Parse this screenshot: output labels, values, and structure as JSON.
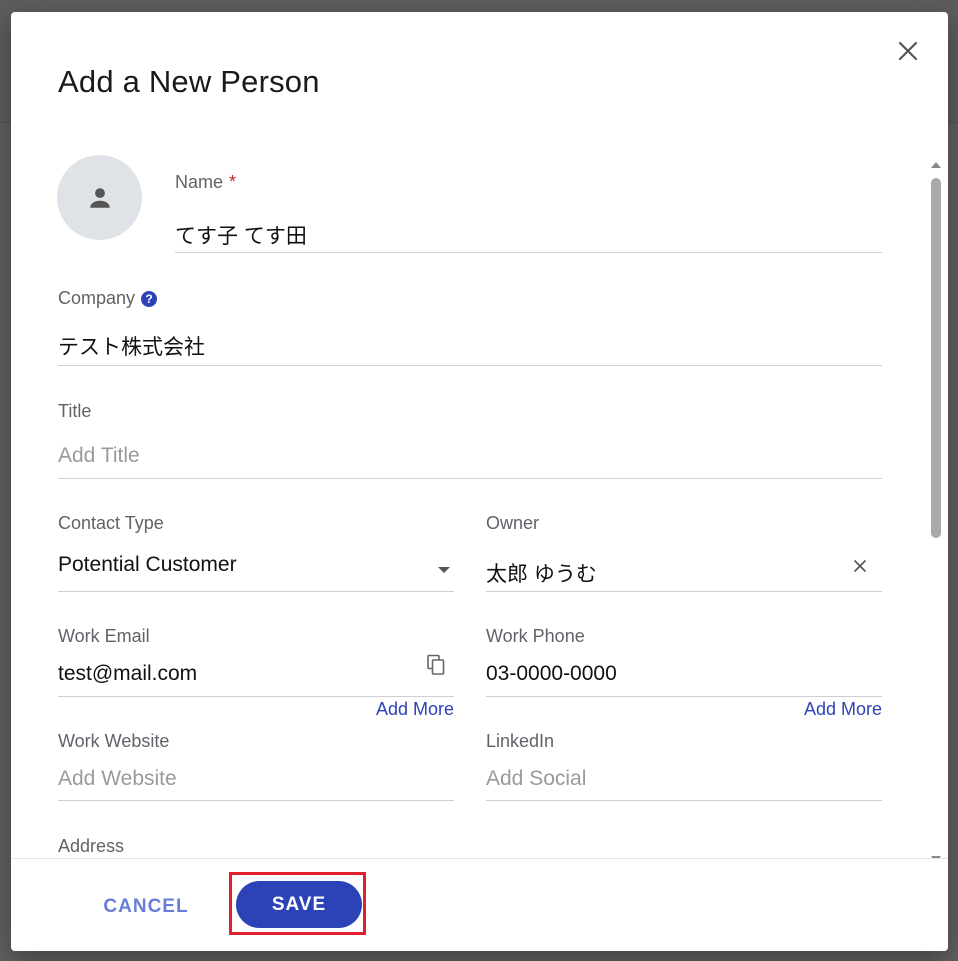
{
  "dialog": {
    "title": "Add a New Person"
  },
  "fields": {
    "name": {
      "label": "Name",
      "required_mark": "*",
      "value": "てす子 てす田"
    },
    "company": {
      "label": "Company",
      "help": "?",
      "value": "テスト株式会社"
    },
    "title": {
      "label": "Title",
      "placeholder": "Add Title"
    },
    "contact_type": {
      "label": "Contact Type",
      "value": "Potential Customer"
    },
    "owner": {
      "label": "Owner",
      "value": "太郎 ゆうむ"
    },
    "work_email": {
      "label": "Work Email",
      "value": "test@mail.com",
      "add_more": "Add More"
    },
    "work_phone": {
      "label": "Work Phone",
      "value": "03-0000-0000",
      "add_more": "Add More"
    },
    "work_website": {
      "label": "Work Website",
      "placeholder": "Add Website"
    },
    "linkedin": {
      "label": "LinkedIn",
      "placeholder": "Add Social"
    },
    "address": {
      "label": "Address"
    }
  },
  "footer": {
    "cancel_label": "CANCEL",
    "save_label": "SAVE"
  },
  "colors": {
    "primary": "#2c43b8",
    "cancel_text": "#6a7ed8",
    "highlight": "#e0202a",
    "required": "#c62828"
  },
  "icons": {
    "close": "close-icon",
    "avatar": "person-icon",
    "help": "help-circle-icon",
    "dropdown": "dropdown-arrow-icon",
    "clear": "clear-icon",
    "copy": "copy-icon"
  }
}
